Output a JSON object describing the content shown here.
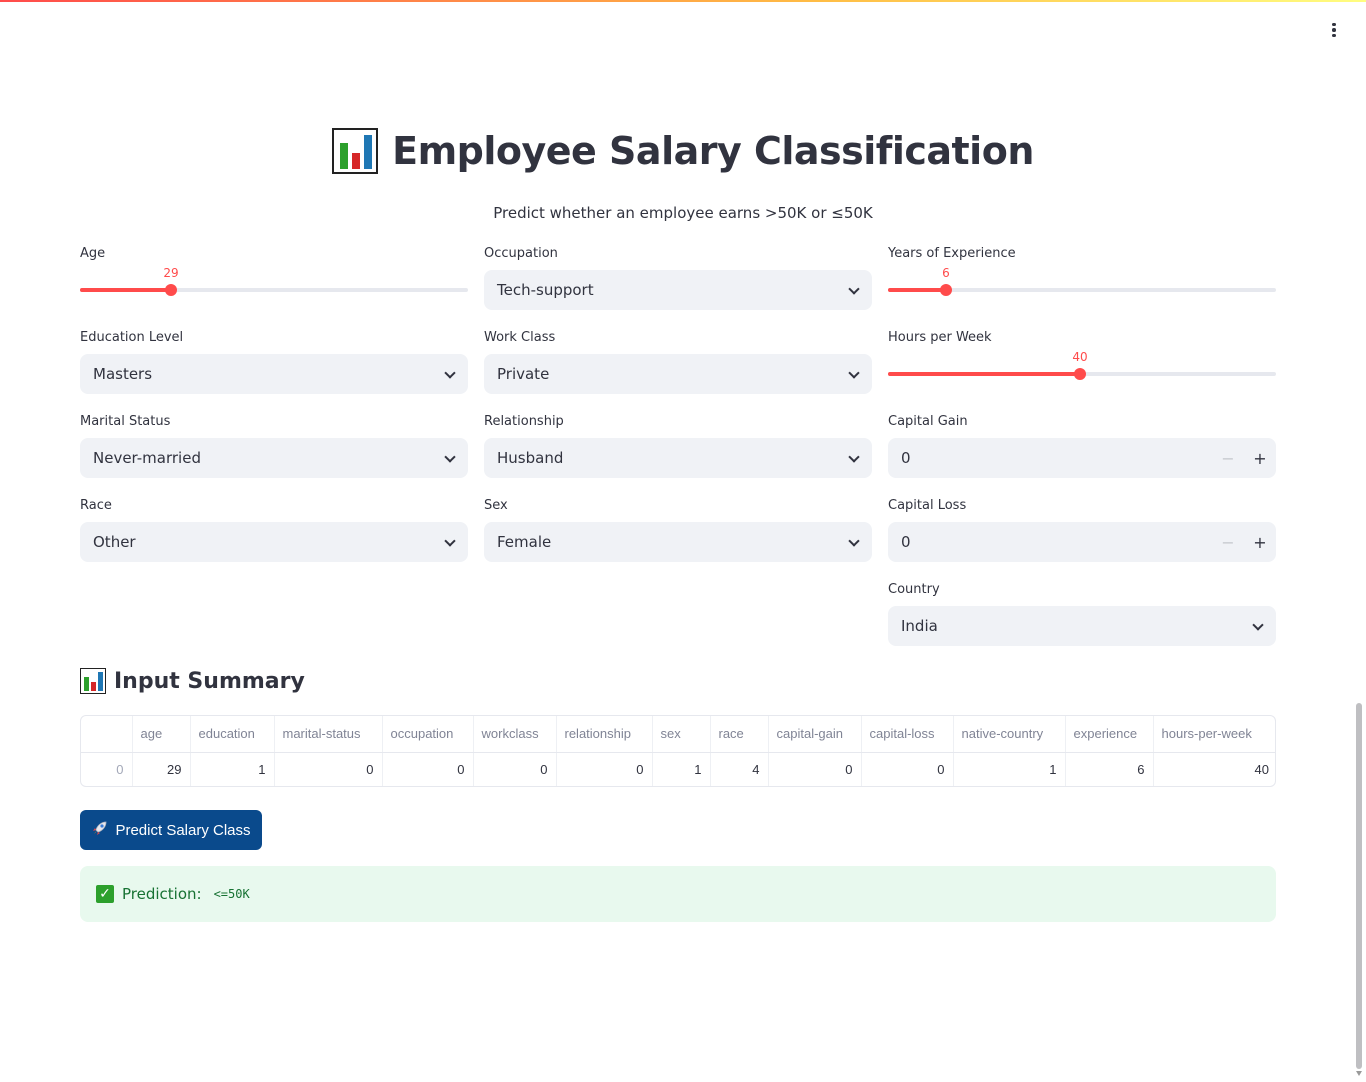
{
  "title": "Employee Salary Classification",
  "subtitle": "Predict whether an employee earns >50K or ≤50K",
  "form": {
    "age": {
      "label": "Age",
      "value": "29",
      "fraction": 0.2333
    },
    "occupation": {
      "label": "Occupation",
      "value": "Tech-support"
    },
    "experience": {
      "label": "Years of Experience",
      "value": "6",
      "fraction": 0.15
    },
    "education": {
      "label": "Education Level",
      "value": "Masters"
    },
    "workclass": {
      "label": "Work Class",
      "value": "Private"
    },
    "hours": {
      "label": "Hours per Week",
      "value": "40",
      "fraction": 0.4949
    },
    "marital": {
      "label": "Marital Status",
      "value": "Never-married"
    },
    "relationship": {
      "label": "Relationship",
      "value": "Husband"
    },
    "capital_gain": {
      "label": "Capital Gain",
      "value": "0"
    },
    "race": {
      "label": "Race",
      "value": "Other"
    },
    "sex": {
      "label": "Sex",
      "value": "Female"
    },
    "capital_loss": {
      "label": "Capital Loss",
      "value": "0"
    },
    "country": {
      "label": "Country",
      "value": "India"
    }
  },
  "summary": {
    "heading": "Input Summary",
    "columns": [
      "",
      "age",
      "education",
      "marital-status",
      "occupation",
      "workclass",
      "relationship",
      "sex",
      "race",
      "capital-gain",
      "capital-loss",
      "native-country",
      "experience",
      "hours-per-week"
    ],
    "row": [
      "0",
      "29",
      "1",
      "0",
      "0",
      "0",
      "0",
      "1",
      "4",
      "0",
      "0",
      "1",
      "6",
      "40"
    ]
  },
  "predict_button": "Predict Salary Class",
  "prediction": {
    "label": "Prediction:",
    "value": "<=50K"
  },
  "icons": {
    "accent": "#ff4b4b",
    "button_bg": "#0a4a8c",
    "success_bg": "#e8f9ee"
  }
}
